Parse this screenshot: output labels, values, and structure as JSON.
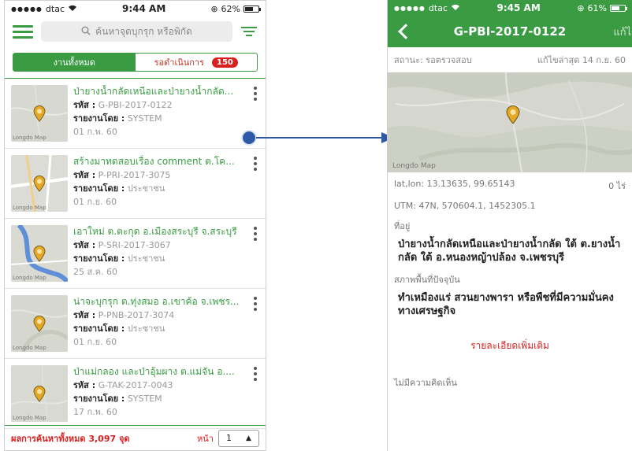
{
  "left": {
    "status": {
      "carrier": "dtac",
      "time": "9:44 AM",
      "battery": "62%",
      "battery_level": 0.62
    },
    "search": {
      "placeholder": "ค้นหาจุดบุกรุก หรือพิกัด"
    },
    "tabs": {
      "all": "งานทั้งหมด",
      "pending": "รอดำเนินการ",
      "pending_count": "150"
    },
    "labels": {
      "code": "รหัส :",
      "reporter": "รายงานโดย :"
    },
    "items": [
      {
        "title": "ป่ายางน้ำกลัดเหนือและป่ายางน้ำกลัด...",
        "code": "G-PBI-2017-0122",
        "reporter": "SYSTEM",
        "date": "01 ก.พ. 60",
        "map_text": "Longdo Map"
      },
      {
        "title": "สร้างมาทดสอบเรื่อง comment ต.โค...",
        "code": "P-PRI-2017-3075",
        "reporter": "ประชาชน",
        "date": "01 ก.ย. 60",
        "map_text": "Longdo Map"
      },
      {
        "title": "เอาใหม่ ต.ตะกุด อ.เมืองสระบุรี จ.สระบุรี",
        "code": "P-SRI-2017-3067",
        "reporter": "ประชาชน",
        "date": "25 ส.ค. 60",
        "map_text": "Longdo Map"
      },
      {
        "title": "น่าจะบุกรุก ต.ทุ่งสมอ อ.เขาค้อ จ.เพชร...",
        "code": "P-PNB-2017-3074",
        "reporter": "ประชาชน",
        "date": "01 ก.ย. 60",
        "map_text": "Longdo Map"
      },
      {
        "title": "ป่าแม่กลอง และป่าอุ้มผาง ต.แม่จัน อ....",
        "code": "G-TAK-2017-0043",
        "reporter": "SYSTEM",
        "date": "17 ก.พ. 60",
        "map_text": "Longdo Map"
      }
    ],
    "footer": {
      "total": "ผลการค้นหาทั้งหมด 3,097 จุด",
      "page_label": "หน้า",
      "page": "1"
    }
  },
  "right": {
    "status": {
      "carrier": "dtac",
      "time": "9:45 AM",
      "battery": "61%",
      "battery_level": 0.61
    },
    "nav": {
      "title": "G-PBI-2017-0122",
      "action": "แก้ไข"
    },
    "state": "สถานะ: รอตรวจสอบ",
    "updated": "แก้ไขล่าสุด 14 ก.ย. 60",
    "map_text": "Longdo Map",
    "latlon": "lat,lon: 13.13635, 99.65143",
    "area": "0 ไร่",
    "utm": "UTM: 47N, 570604.1, 1452305.1",
    "address_label": "ที่อยู่",
    "address_line1": "ป่ายางน้ำกลัดเหนือและป่ายางน้ำกลัด ใต้ ต.ยางน้ำ",
    "address_line2": "กลัด ใต้ อ.หนองหญ้าปล้อง จ.เพชรบุรี",
    "condition_label": "สภาพพื้นที่ปัจจุบัน",
    "condition_line1": "ทำเหมืองแร่ สวนยางพารา หรือพืชที่มีความมั่นคง",
    "condition_line2": "ทางเศรษฐกิจ",
    "more_link": "รายละเอียดเพิ่มเติม",
    "comments": "ไม่มีความคิดเห็น"
  },
  "colors": {
    "green": "#3a9b43",
    "red": "#d9201f",
    "pin": "#e5a825"
  }
}
